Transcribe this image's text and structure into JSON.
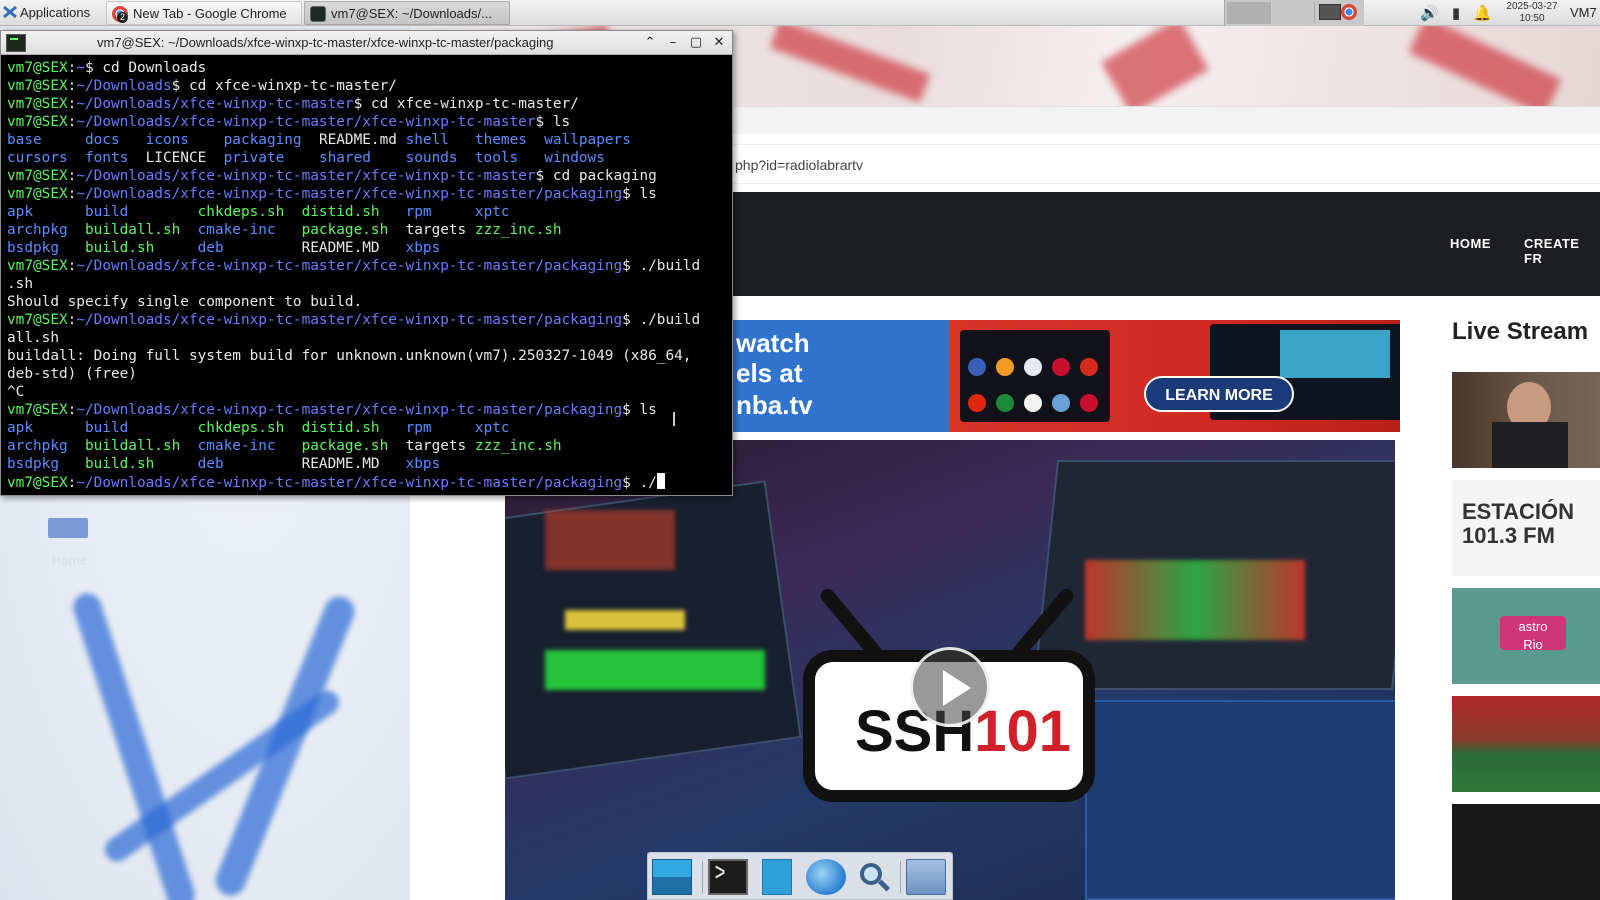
{
  "panel": {
    "applications_label": "Applications",
    "tasks": [
      {
        "label": "New Tab - Google Chrome",
        "badge": "2"
      },
      {
        "label": "vm7@SEX: ~/Downloads/..."
      }
    ],
    "clock_date": "2025-03-27",
    "clock_time": "10:50",
    "user": "VM7"
  },
  "browser": {
    "url_fragment": "php?id=radiolabrartv",
    "nav": [
      "HOME",
      "CREATE FR"
    ],
    "ad": {
      "line1": "watch",
      "line2": "els at",
      "line3": "nba.tv",
      "cta": "LEARN MORE"
    },
    "video_logo_a": "SSH",
    "video_logo_b": "101",
    "live_title": "Live Stream",
    "thumbs": [
      {
        "text": "ESTACIÓN\n101.3 FM"
      },
      {
        "text": "astro\nRio"
      }
    ]
  },
  "desktop": {
    "home_label": "Home"
  },
  "terminal": {
    "title": "vm7@SEX: ~/Downloads/xfce-winxp-tc-master/xfce-winxp-tc-master/packaging",
    "prompt_user": "vm7@SEX",
    "lines": [
      {
        "path": "~",
        "cmd": "cd Downloads"
      },
      {
        "path": "~/Downloads",
        "cmd": "cd xfce-winxp-tc-master/"
      },
      {
        "path": "~/Downloads/xfce-winxp-tc-master",
        "cmd": "cd xfce-winxp-tc-master/"
      },
      {
        "path": "~/Downloads/xfce-winxp-tc-master/xfce-winxp-tc-master",
        "cmd": "ls"
      }
    ],
    "ls_root": [
      [
        "base",
        "docs",
        "icons",
        "packaging",
        "README.md",
        "shell",
        "themes",
        "wallpapers"
      ],
      [
        "cursors",
        "fonts",
        "LICENCE",
        "private",
        "shared",
        "sounds",
        "tools",
        "windows"
      ]
    ],
    "cd_packaging": {
      "path": "~/Downloads/xfce-winxp-tc-master/xfce-winxp-tc-master",
      "cmd": "cd packaging"
    },
    "packaging_path": "~/Downloads/xfce-winxp-tc-master/xfce-winxp-tc-master/packaging",
    "ls_pkg": [
      [
        "apk",
        "build",
        "chkdeps.sh",
        "distid.sh",
        "rpm",
        "xptc"
      ],
      [
        "archpkg",
        "buildall.sh",
        "cmake-inc",
        "package.sh",
        "targets",
        "zzz_inc.sh"
      ],
      [
        "bsdpkg",
        "build.sh",
        "deb",
        "README.MD",
        "xbps"
      ]
    ],
    "cmd_build": "./build",
    "cmd_build_wrap": ".sh",
    "out_build": "Should specify single component to build.",
    "cmd_buildall": "./build",
    "cmd_buildall_wrap": "all.sh",
    "out_buildall_1": "buildall: Doing full system build for unknown.unknown(vm7).250327-1049 (x86_64,",
    "out_buildall_2": "deb-std) (free)",
    "out_ctrlc": "^C",
    "cmd_ls": "ls",
    "cmd_current": "./"
  }
}
